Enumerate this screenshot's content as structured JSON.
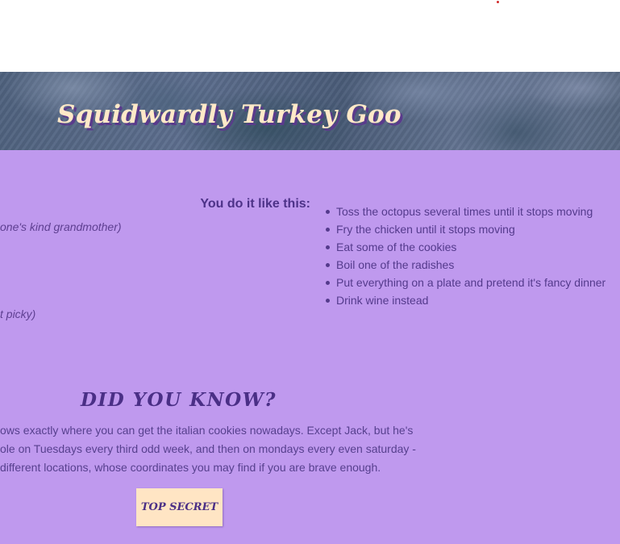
{
  "header": {
    "title": "Squidwardly Turkey Goo"
  },
  "ingredients": {
    "line_1": "one's kind grandmother)",
    "line_2": "t picky)"
  },
  "steps": {
    "heading": "You do it like this:",
    "items": [
      "Toss the octopus several times until it stops moving",
      "Fry the chicken until it stops moving",
      "Eat some of the cookies",
      "Boil one of the radishes",
      "Put everything on a plate and pretend it's fancy dinner",
      "Drink wine instead"
    ]
  },
  "did_you_know": {
    "heading": "DID YOU KNOW?",
    "lines": [
      "ows exactly where you can get the italian cookies nowadays. Except Jack, but he's",
      "ole on Tuesdays every third odd week, and then on mondays every even saturday -",
      " different locations, whose coordinates you may find if you are brave enough."
    ],
    "button_label": "TOP SECRET"
  },
  "colors": {
    "content_background": "#bf99ee",
    "banner_title": "#ffe9c8",
    "button_background": "#ffe5c4",
    "text": "#4d3288"
  }
}
